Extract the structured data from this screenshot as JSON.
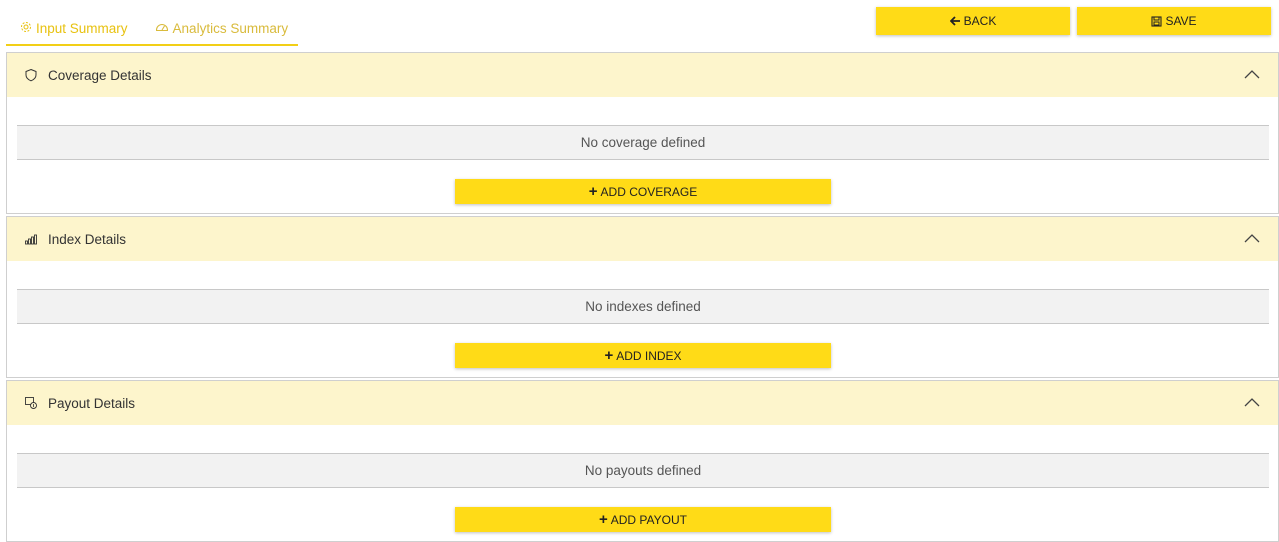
{
  "tabs": {
    "input_summary": "Input Summary",
    "analytics_summary": "Analytics Summary"
  },
  "toolbar": {
    "back_label": "BACK",
    "save_label": "SAVE"
  },
  "sections": {
    "coverage": {
      "title": "Coverage Details",
      "empty_text": "No coverage defined",
      "add_label": "ADD COVERAGE"
    },
    "index": {
      "title": "Index Details",
      "empty_text": "No indexes defined",
      "add_label": "ADD INDEX"
    },
    "payout": {
      "title": "Payout Details",
      "empty_text": "No payouts defined",
      "add_label": "ADD PAYOUT"
    }
  },
  "colors": {
    "accent": "#ffdb17",
    "header_bg": "#fdf5cc",
    "tab_accent": "#f2cf16"
  },
  "icons": {
    "input_summary": "gear-icon",
    "analytics_summary": "gauge-icon",
    "back": "arrow-left-icon",
    "save": "save-icon",
    "coverage": "shield-icon",
    "index": "signal-bars-icon",
    "payout": "payout-icon",
    "collapse": "chevron-up-icon",
    "add": "plus-icon"
  }
}
